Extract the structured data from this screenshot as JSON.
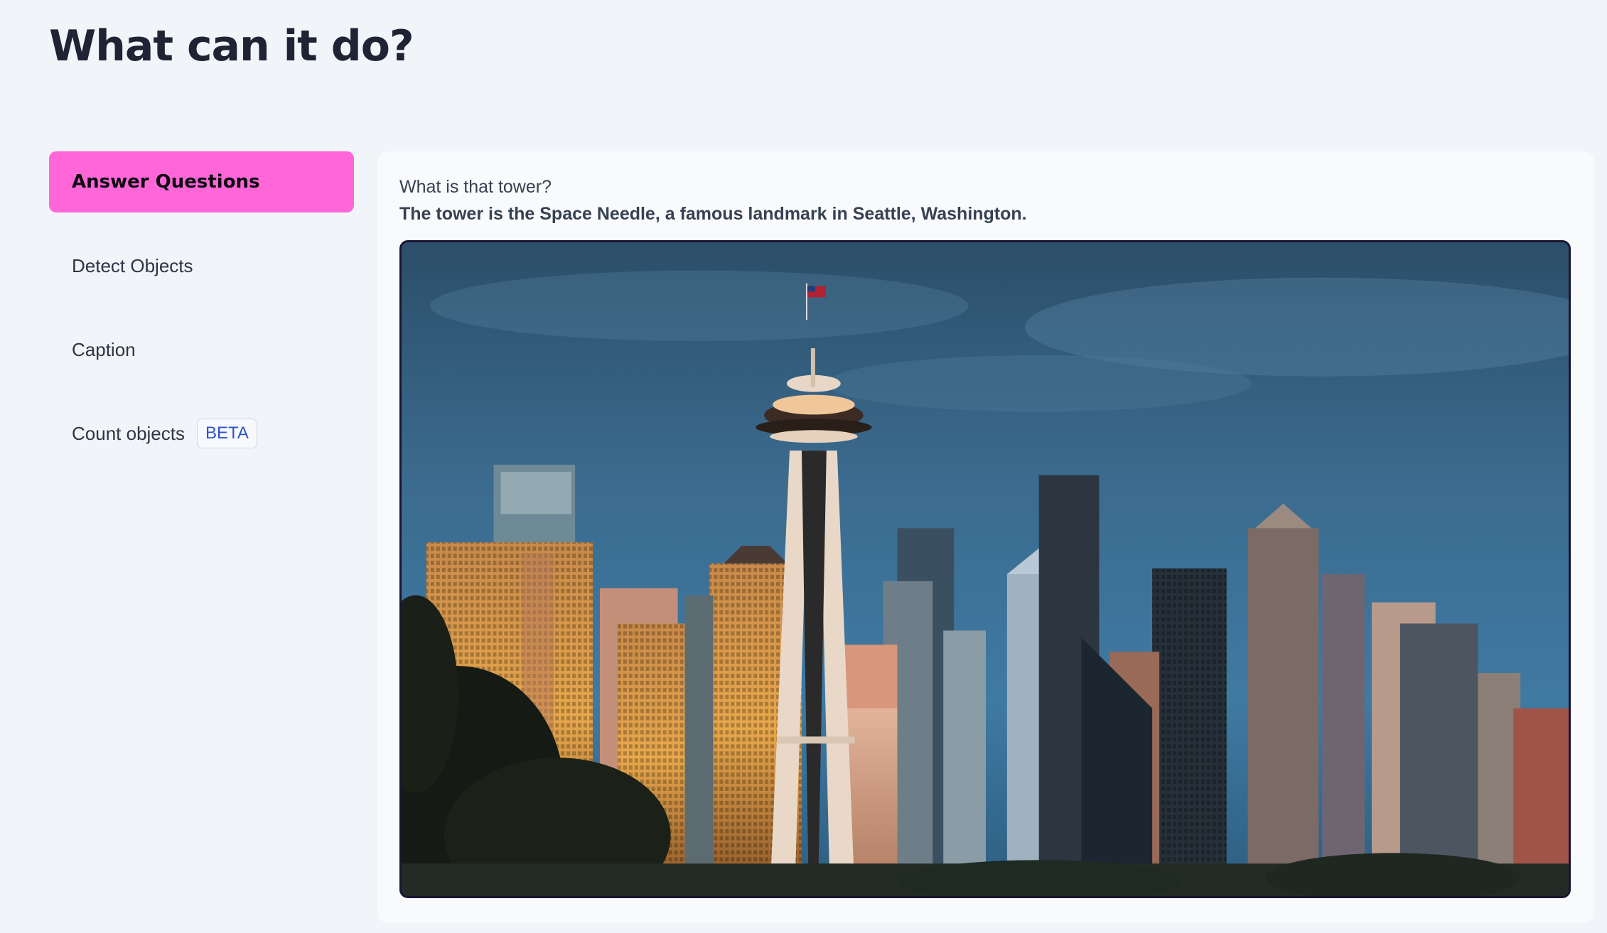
{
  "page": {
    "title": "What can it do?"
  },
  "sidebar": {
    "items": [
      {
        "label": "Answer Questions",
        "active": true
      },
      {
        "label": "Detect Objects",
        "active": false
      },
      {
        "label": "Caption",
        "active": false
      },
      {
        "label": "Count objects",
        "active": false,
        "badge": "BETA"
      }
    ]
  },
  "demo": {
    "question": "What is that tower?",
    "answer": "The tower is the Space Needle, a famous landmark in Seattle, Washington."
  },
  "colors": {
    "active_tab": "#ff66d8",
    "background": "#f1f4f8",
    "panel": "#f8fafc",
    "badge_text": "#2f54c8"
  }
}
